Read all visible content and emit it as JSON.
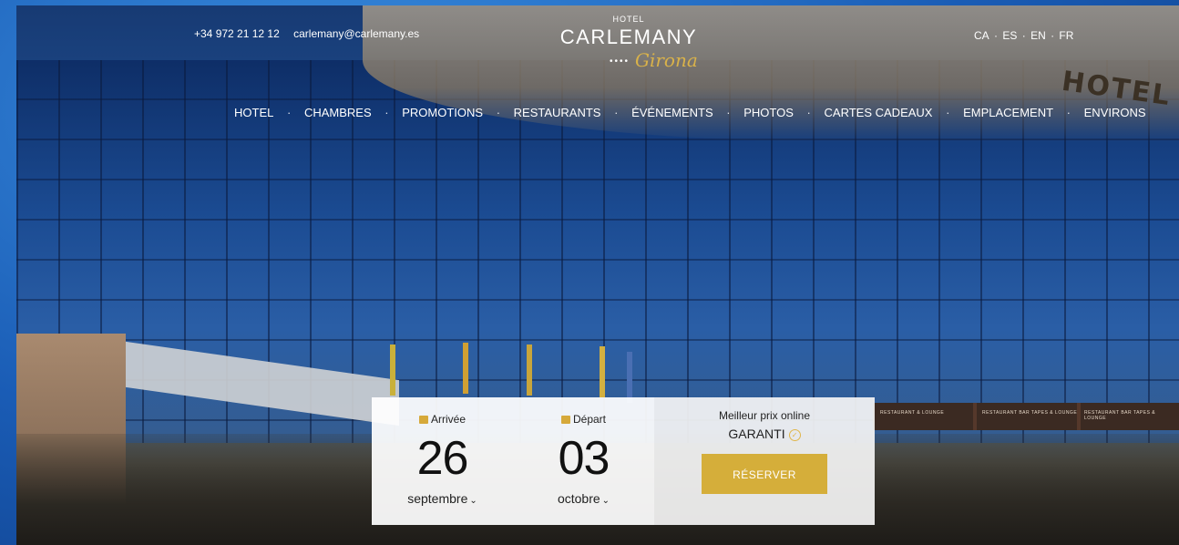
{
  "header": {
    "phone": "+34 972 21 12 12",
    "email": "carlemany@carlemany.es",
    "logo": {
      "small": "HOTEL",
      "name": "CARLEMANY",
      "script": "Girona",
      "dots": "••••"
    },
    "languages": [
      "CA",
      "ES",
      "EN",
      "FR"
    ],
    "language_separator": "·"
  },
  "nav": {
    "items": [
      "HOTEL",
      "CHAMBRES",
      "PROMOTIONS",
      "RESTAURANTS",
      "ÉVÉNEMENTS",
      "PHOTOS",
      "CARTES CADEAUX",
      "EMPLACEMENT",
      "ENVIRONS"
    ],
    "separator": "·"
  },
  "background": {
    "building_sign": "HOTEL",
    "awning_labels": [
      "RESTAURANT & LOUNGE",
      "RESTAURANT BAR TAPES & LOUNGE",
      "RESTAURANT BAR TAPES & LOUNGE"
    ]
  },
  "booking": {
    "arrival": {
      "label": "Arrivée",
      "day": "26",
      "month": "septembre"
    },
    "departure": {
      "label": "Départ",
      "day": "03",
      "month": "octobre"
    },
    "best_price_line1": "Meilleur prix online",
    "best_price_line2": "GARANTI",
    "reserve_button": "RÉSERVER"
  },
  "colors": {
    "accent": "#d5ae3a",
    "frame": "#1a5db8"
  }
}
